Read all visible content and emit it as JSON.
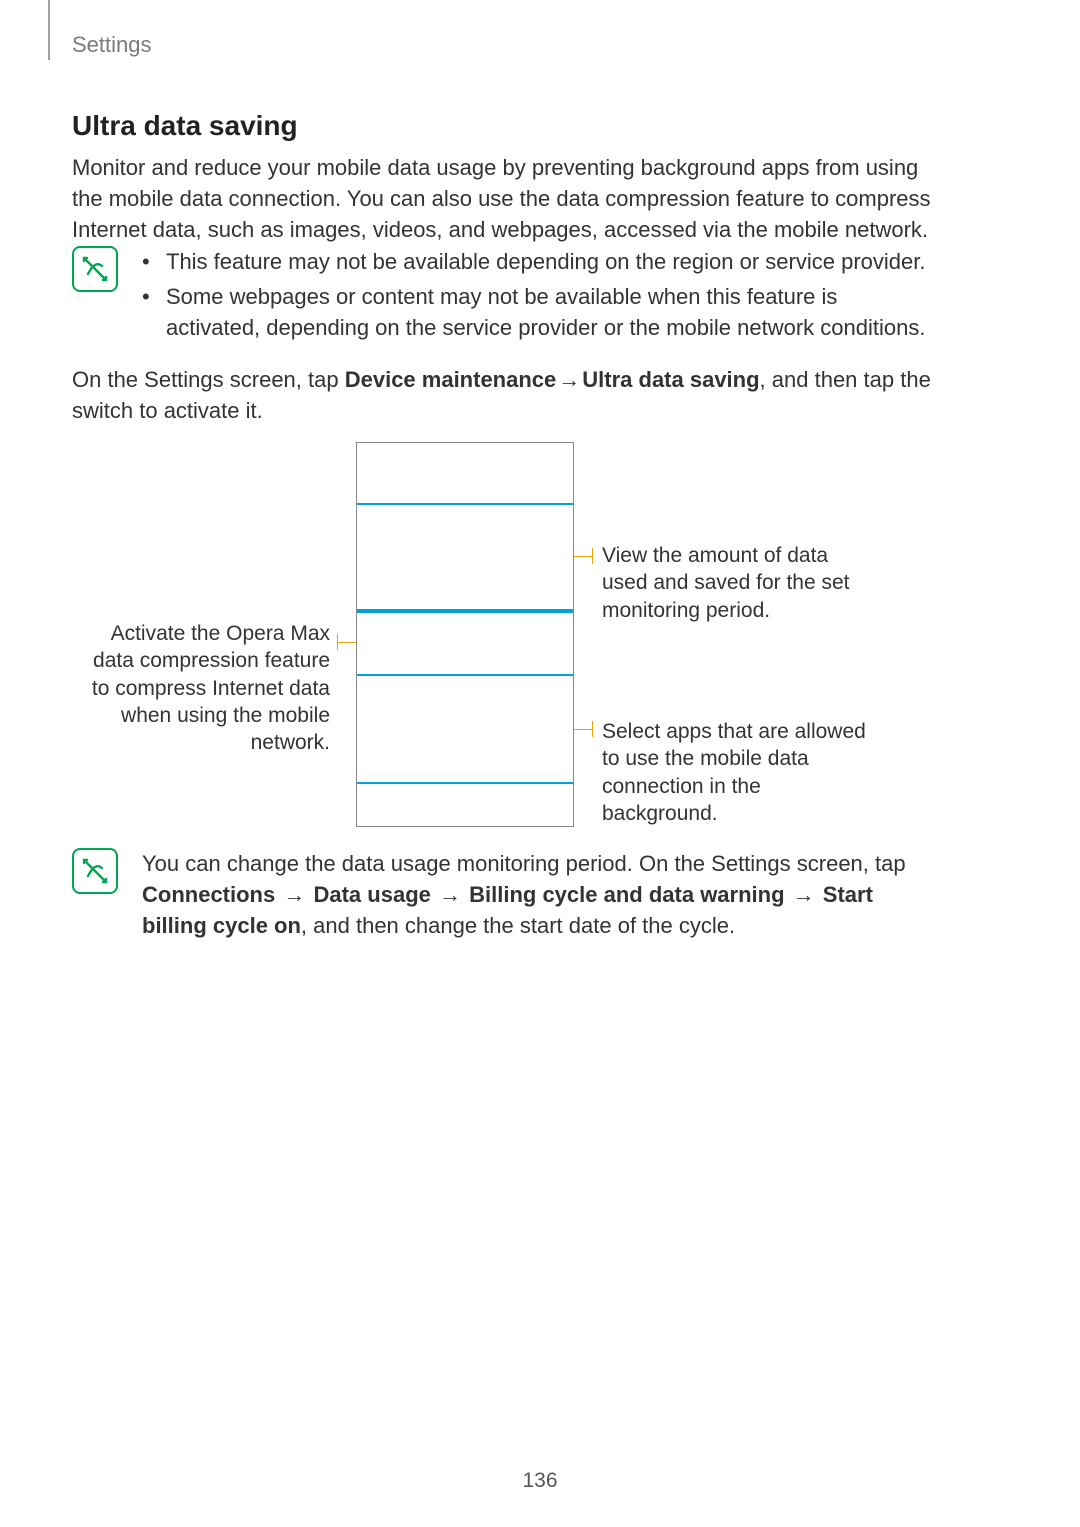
{
  "header": {
    "section": "Settings"
  },
  "title": "Ultra data saving",
  "intro": "Monitor and reduce your mobile data usage by preventing background apps from using the mobile data connection. You can also use the data compression feature to compress Internet data, such as images, videos, and webpages, accessed via the mobile network.",
  "note1": {
    "items": [
      "This feature may not be available depending on the region or service provider.",
      "Some webpages or content may not be available when this feature is activated, depending on the service provider or the mobile network conditions."
    ]
  },
  "path": {
    "prefix": "On the Settings screen, tap ",
    "step1": "Device maintenance",
    "arrow": "→",
    "step2": "Ultra data saving",
    "suffix": ", and then tap the switch to activate it."
  },
  "callouts": {
    "left": "Activate the Opera Max data compression feature to compress Internet data when using the mobile network.",
    "right_top": "View the amount of data used and saved for the set monitoring period.",
    "right_bottom": "Select apps that are allowed to use the mobile data connection in the background."
  },
  "note2": {
    "prefix": "You can change the data usage monitoring period. On the Settings screen, tap ",
    "p1": "Connections",
    "p2": "Data usage",
    "p3": "Billing cycle and data warning",
    "p4": "Start billing cycle on",
    "arrow": "→",
    "suffix": ", and then change the start date of the cycle."
  },
  "page_number": "136"
}
